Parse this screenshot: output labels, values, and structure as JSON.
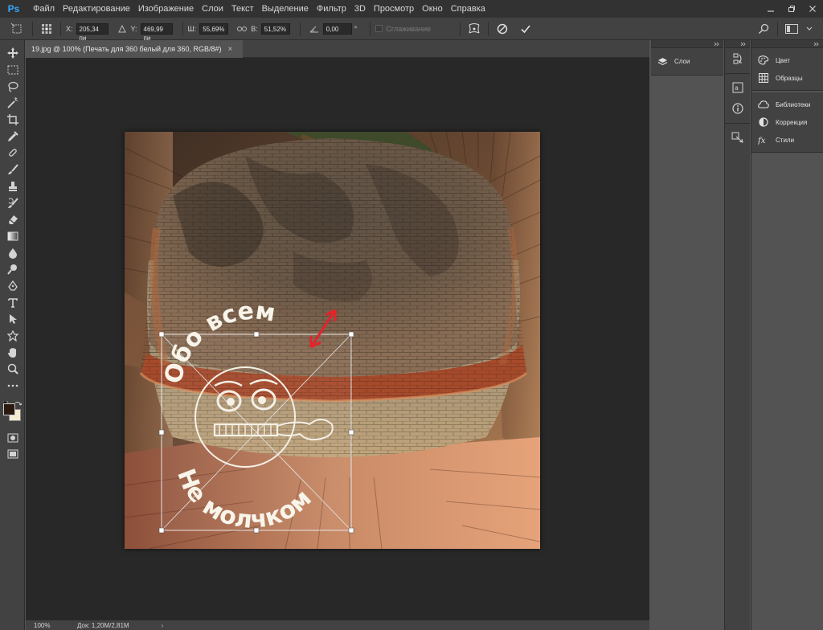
{
  "app": {
    "logo": "Ps"
  },
  "menu": [
    "Файл",
    "Редактирование",
    "Изображение",
    "Слои",
    "Текст",
    "Выделение",
    "Фильтр",
    "3D",
    "Просмотр",
    "Окно",
    "Справка"
  ],
  "options": {
    "x_label": "X:",
    "x_value": "205,34 пи",
    "y_label": "Y:",
    "y_value": "469,99 пи",
    "w_label": "Ш:",
    "w_value": "55,69%",
    "h_label": "В:",
    "h_value": "51,52%",
    "angle_value": "0,00",
    "angle_unit": "°",
    "smoothing_label": "Сглаживание"
  },
  "document": {
    "tab_title": "19.jpg @ 100% (Печать для 360 белый для 360, RGB/8#)",
    "tab_close": "×",
    "overlay_text_top": "Обо всем",
    "overlay_text_bottom": "Не молчком"
  },
  "status": {
    "zoom": "100%",
    "doc_info": "Док: 1,20M/2,81M",
    "arrow": "›"
  },
  "panels": {
    "layers": "Слои",
    "color": "Цвет",
    "swatches": "Образцы",
    "libraries": "Библиотеки",
    "adjustments": "Коррекция",
    "styles": "Стили"
  },
  "colors": {
    "accent": "#31a8ff",
    "arrow_red": "#e3242b",
    "bg": "#535353",
    "dark": "#282828"
  }
}
